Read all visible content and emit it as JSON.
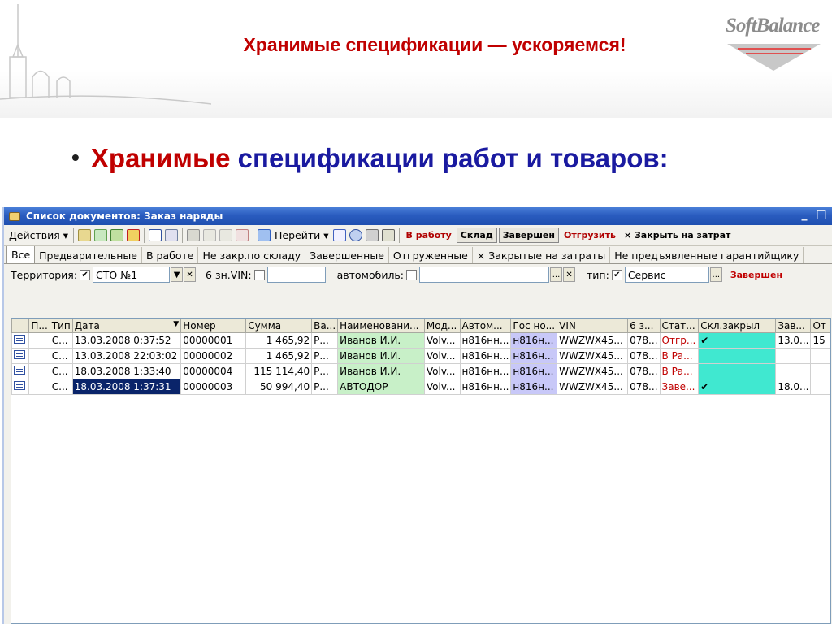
{
  "slide": {
    "title": "Хранимые спецификации — ускоряемся!",
    "logo_text": "SoftBalance",
    "bullet": {
      "part1": "Хранимые",
      "part2": "спецификации работ и товаров:"
    }
  },
  "window": {
    "title": "Список документов: Заказ наряды",
    "minimize": "_",
    "maximize": "□"
  },
  "toolbar": {
    "actions_label": "Действия ▾",
    "goto_label": "Перейти ▾",
    "btn_to_work": "В работу",
    "btn_warehouse": "Склад",
    "btn_finished": "Завершен",
    "btn_ship": "Отгрузить",
    "btn_close_costs": "× Закрыть на затрат"
  },
  "tabs": [
    "Все",
    "Предварительные",
    "В работе",
    "Не закр.по складу",
    "Завершенные",
    "Отгруженные",
    "× Закрытые на затраты",
    "Не предъявленные гарантийщику"
  ],
  "filter": {
    "territory_label": "Территория:",
    "territory_value": "СТО №1",
    "vin_label": "6 зн.VIN:",
    "car_label": "автомобиль:",
    "type_label": "тип:",
    "type_value": "Сервис",
    "status_text": "Завершен"
  },
  "table": {
    "headers": [
      "",
      "П...",
      "Тип",
      "Дата",
      "Номер",
      "Сумма",
      "Ва...",
      "Наименовани...",
      "Мод...",
      "Автом...",
      "Гос но...",
      "VIN",
      "6 з...",
      "Стат...",
      "Скл.закрыл",
      "Зав...",
      "От"
    ],
    "rows": [
      {
        "type": "С...",
        "date": "13.03.2008 0:37:52",
        "number": "00000001",
        "sum": "1 465,92",
        "cur": "Р...",
        "name": "Иванов И.И.",
        "model": "Volv...",
        "auto": "н816нн...",
        "gos": "н816н...",
        "vin": "WWZWX45...",
        "six": "078...",
        "status": "Отгр...",
        "closed": "✔",
        "fin": "13.0...",
        "ot": "15"
      },
      {
        "type": "С...",
        "date": "13.03.2008 22:03:02",
        "number": "00000002",
        "sum": "1 465,92",
        "cur": "Р...",
        "name": "Иванов И.И.",
        "model": "Volv...",
        "auto": "н816нн...",
        "gos": "н816н...",
        "vin": "WWZWX45...",
        "six": "078...",
        "status": "В Ра...",
        "closed": "",
        "fin": "",
        "ot": ""
      },
      {
        "type": "С...",
        "date": "18.03.2008 1:33:40",
        "number": "00000004",
        "sum": "115 114,40",
        "cur": "Р...",
        "name": "Иванов И.И.",
        "model": "Volv...",
        "auto": "н816нн...",
        "gos": "н816н...",
        "vin": "WWZWX45...",
        "six": "078...",
        "status": "В Ра...",
        "closed": "",
        "fin": "",
        "ot": ""
      },
      {
        "type": "С...",
        "date": "18.03.2008 1:37:31",
        "number": "00000003",
        "sum": "50 994,40",
        "cur": "Р...",
        "name": "АВТОДОР",
        "model": "Volv...",
        "auto": "н816нн...",
        "gos": "н816н...",
        "vin": "WWZWX45...",
        "six": "078...",
        "status": "Заве...",
        "closed": "✔",
        "fin": "18.0...",
        "ot": ""
      }
    ]
  },
  "colors": {
    "title_red": "#c00000",
    "bullet_blue": "#1a1aa0",
    "titlebar_blue": "#2a5cbf",
    "closed_cyan": "#40e8d0"
  }
}
